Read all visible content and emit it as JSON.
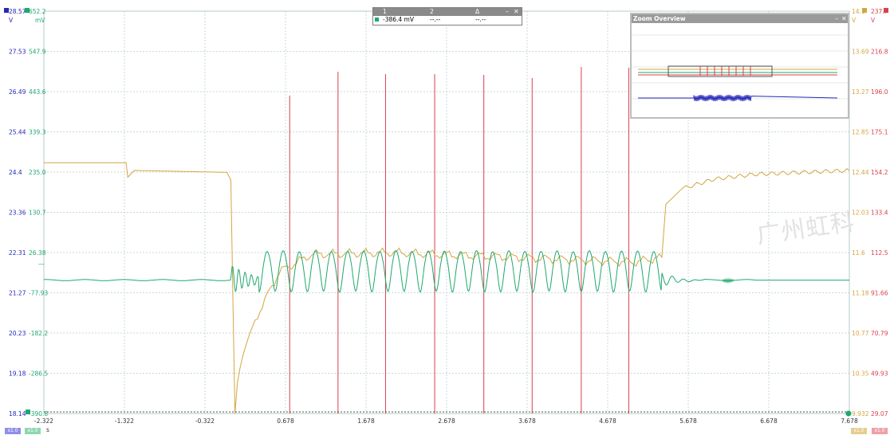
{
  "colors": {
    "ch_blue": "#2626b8",
    "ch_green": "#1ea86e",
    "ch_orange": "#d4a640",
    "ch_red": "#d9404f",
    "grid": "#c8d8d8"
  },
  "time_axis": {
    "ticks": [
      "-2.322",
      "-1.322",
      "-0.322",
      "0.678",
      "1.678",
      "2.678",
      "3.678",
      "4.678",
      "5.678",
      "6.678",
      "7.678"
    ],
    "unit": "s"
  },
  "left_axes": {
    "blue": {
      "ticks": [
        "28.57",
        "27.53",
        "26.49",
        "25.44",
        "24.4",
        "23.36",
        "22.31",
        "21.27",
        "20.23",
        "19.18",
        "18.14"
      ],
      "unit": "V"
    },
    "green": {
      "ticks": [
        "652.2",
        "547.9",
        "443.6",
        "339.3",
        "235.0",
        "130.7",
        "26.38",
        "-77.93",
        "-182.2",
        "-286.5",
        "-390.8"
      ],
      "unit": "mV"
    }
  },
  "right_axes": {
    "orange": {
      "ticks": [
        "14.1",
        "13.69",
        "13.27",
        "12.85",
        "12.44",
        "12.03",
        "11.6",
        "11.18",
        "10.77",
        "10.35",
        "9.932"
      ],
      "unit": "V"
    },
    "red": {
      "ticks": [
        "237.7",
        "216.8",
        "196.0",
        "175.1",
        "154.2",
        "133.4",
        "112.5",
        "91.66",
        "70.79",
        "49.93",
        "29.07"
      ],
      "unit": "V"
    }
  },
  "measurement": {
    "headers": [
      "1",
      "2",
      "Δ"
    ],
    "values": [
      "-386.4 mV",
      "--.--",
      "--.--"
    ]
  },
  "zoom_overview": {
    "title": "Zoom Overview"
  },
  "window_controls": {
    "minimize": "–",
    "close": "✕"
  },
  "chips": {
    "blue": "x1.0",
    "green": "x1.0",
    "orange": "x1.0",
    "red": "x1.0"
  },
  "watermark": "广州虹科",
  "chart_data": {
    "type": "line",
    "x_range": [
      -2.322,
      7.678
    ],
    "series": [
      {
        "color": "orange",
        "description_axis": "right V 9.932-14.1",
        "points": [
          [
            -2.322,
            12.53
          ],
          [
            -1.3,
            12.53
          ],
          [
            -1.28,
            12.38
          ],
          [
            -1.2,
            12.45
          ],
          [
            -0.05,
            12.43
          ],
          [
            -0.0,
            12.35
          ],
          [
            0.05,
            9.9
          ],
          [
            0.3,
            10.9
          ],
          [
            0.6,
            11.4
          ],
          [
            1.0,
            11.58
          ],
          [
            2.0,
            11.6
          ],
          [
            5.0,
            11.5
          ],
          [
            5.35,
            11.55
          ],
          [
            5.4,
            12.1
          ],
          [
            5.6,
            12.26
          ],
          [
            6.0,
            12.36
          ],
          [
            6.5,
            12.41
          ],
          [
            7.678,
            12.45
          ]
        ]
      },
      {
        "color": "green",
        "description_axis": "left mV",
        "baseline_mV": -45,
        "oscillation_start_s": 0.0,
        "oscillation_end_s": 5.35,
        "period_s": 0.2
      },
      {
        "color": "red",
        "description_axis": "right V",
        "spike_times_s": [
          0.73,
          1.33,
          1.92,
          2.53,
          3.14,
          3.74,
          4.35,
          4.94
        ]
      }
    ]
  }
}
